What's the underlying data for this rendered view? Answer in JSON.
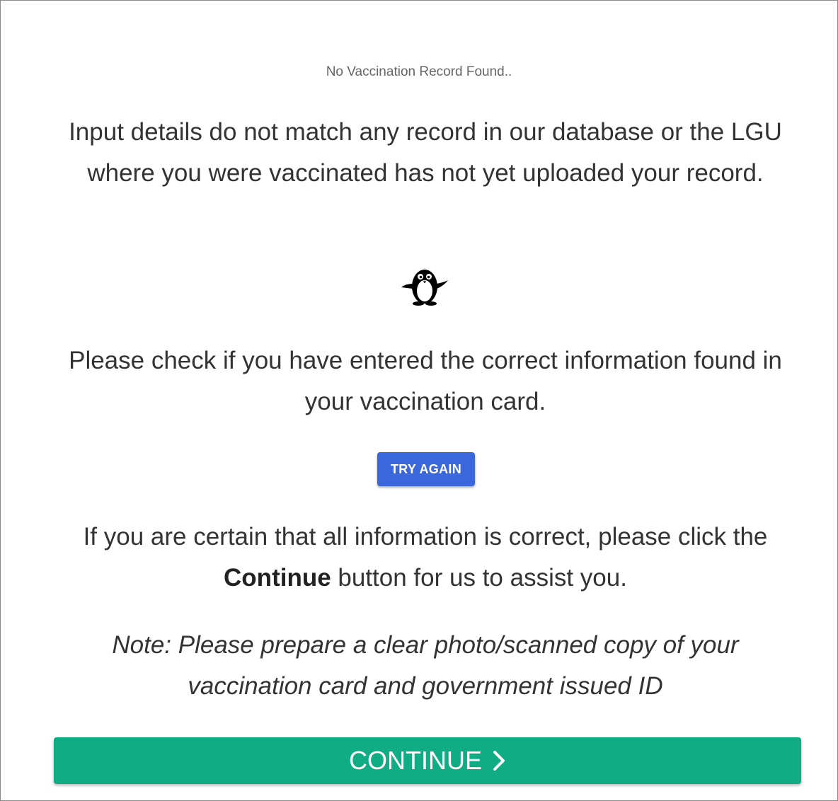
{
  "header": {
    "subtitle": "No Vaccination Record Found.."
  },
  "message": {
    "paragraph1": "Input details do not match any record in our database or the LGU where you were vaccinated has not yet uploaded your record.",
    "paragraph2": "Please check if you have entered the correct information found in your vaccination card.",
    "paragraph3_before": "If you are certain that all information is correct, please click the ",
    "paragraph3_bold": "Continue",
    "paragraph3_after": " button for us to assist you.",
    "note": "Note: Please prepare a clear photo/scanned copy of your vaccination card and government issued ID"
  },
  "illustration": {
    "icon": "penguin-icon"
  },
  "buttons": {
    "try_again_label": "TRY AGAIN",
    "continue_label": "CONTINUE",
    "continue_icon": "chevron-right-icon"
  },
  "colors": {
    "try_again_bg": "#3a68dc",
    "continue_bg": "#10ad84",
    "text": "#333333",
    "subtitle": "#666666"
  }
}
